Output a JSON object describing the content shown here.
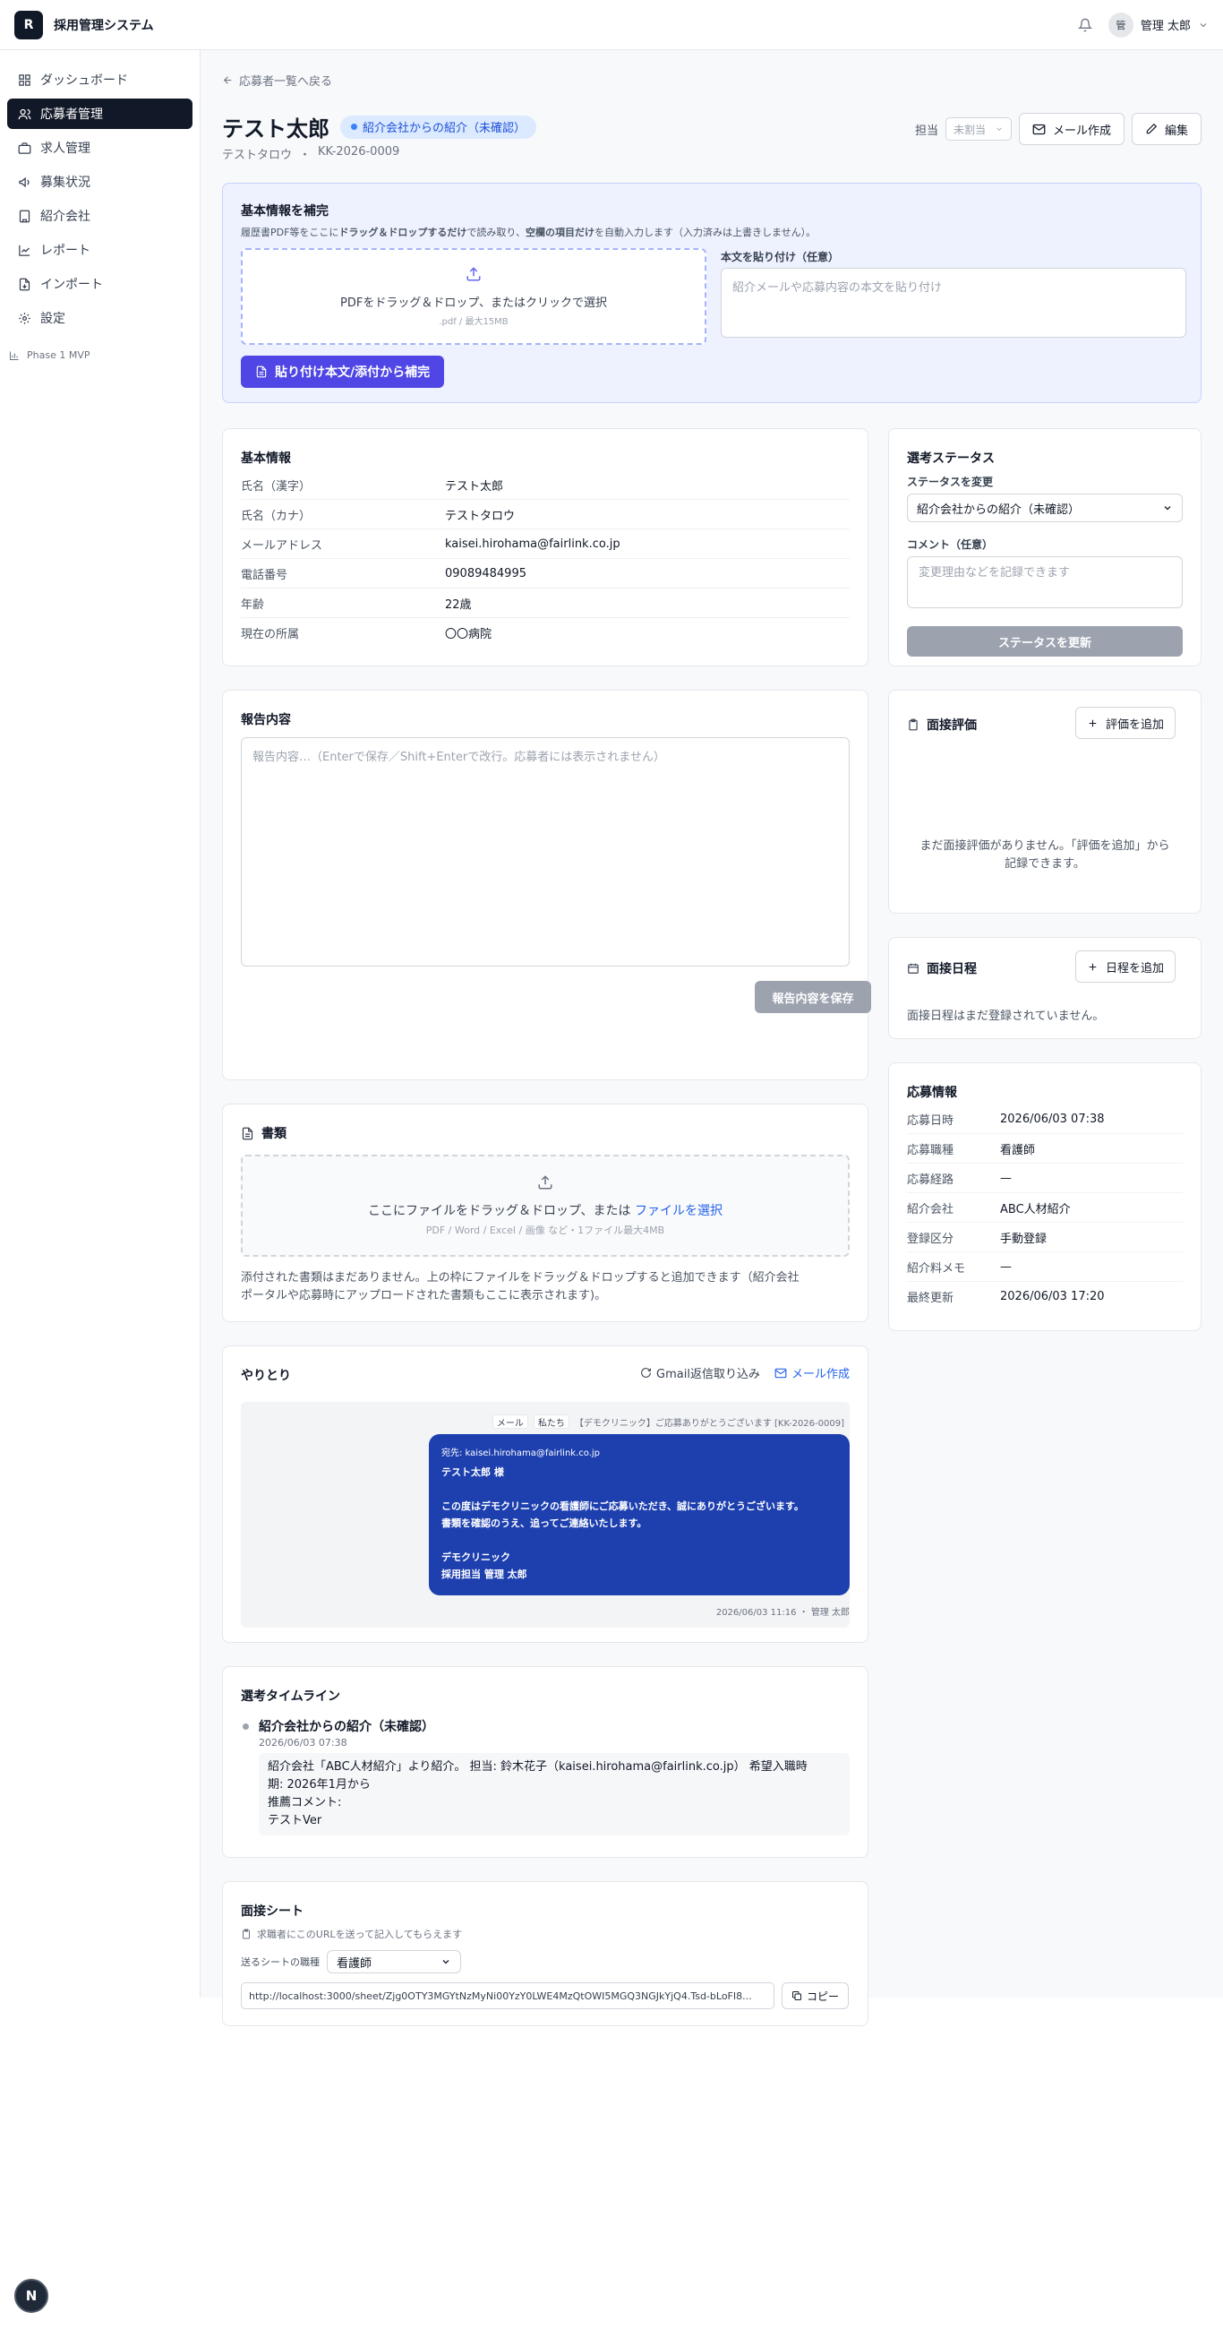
{
  "app": {
    "logo_letter": "R",
    "title": "採用管理システム",
    "user_initial": "管",
    "user_name": "管理 太郎"
  },
  "sidebar": {
    "items": [
      {
        "label": "ダッシュボード",
        "icon": "dashboard-icon"
      },
      {
        "label": "応募者管理",
        "icon": "users-icon",
        "active": true
      },
      {
        "label": "求人管理",
        "icon": "briefcase-icon"
      },
      {
        "label": "募集状況",
        "icon": "megaphone-icon"
      },
      {
        "label": "紹介会社",
        "icon": "building-icon"
      },
      {
        "label": "レポート",
        "icon": "chart-line-icon"
      },
      {
        "label": "インポート",
        "icon": "file-import-icon"
      },
      {
        "label": "設定",
        "icon": "gear-icon"
      }
    ],
    "phase_label": "Phase 1 MVP"
  },
  "page": {
    "back_link": "応募者一覧へ戻る",
    "name": "テスト太郎",
    "status_badge": "紹介会社からの紹介（未確認）",
    "kana": "テストタロウ",
    "separator": "・",
    "applicant_id": "KK-2026-0009",
    "assign_label": "担当",
    "assign_value": "未割当",
    "mail_button": "メール作成",
    "edit_button": "編集"
  },
  "supplement": {
    "title": "基本情報を補完",
    "desc_1": "履歴書PDF等をここに",
    "desc_2": "ドラッグ＆ドロップするだけ",
    "desc_3": "で読み取り、",
    "desc_4": "空欄の項目だけ",
    "desc_5": "を自動入力します（入力済みは上書きしません）。",
    "drop_text": "PDFをドラッグ＆ドロップ、またはクリックで選択",
    "drop_hint": ".pdf / 最大15MB",
    "paste_label": "本文を貼り付け（任意）",
    "paste_placeholder": "紹介メールや応募内容の本文を貼り付け",
    "button": "貼り付け本文/添付から補完"
  },
  "basic_info": {
    "title": "基本情報",
    "rows": [
      {
        "label": "氏名（漢字）",
        "value": "テスト太郎"
      },
      {
        "label": "氏名（カナ）",
        "value": "テストタロウ"
      },
      {
        "label": "メールアドレス",
        "value": "kaisei.hirohama@fairlink.co.jp"
      },
      {
        "label": "電話番号",
        "value": "09089484995"
      },
      {
        "label": "年齢",
        "value": "22歳"
      },
      {
        "label": "現在の所属",
        "value": "〇〇病院"
      }
    ]
  },
  "report": {
    "title": "報告内容",
    "placeholder": "報告内容…（Enterで保存／Shift+Enterで改行。応募者には表示されません）",
    "save_button": "報告内容を保存"
  },
  "documents": {
    "title": "書類",
    "drop_text": "ここにファイルをドラッグ＆ドロップ、または",
    "drop_link": "ファイルを選択",
    "drop_hint": "PDF / Word / Excel / 画像 など・1ファイル最大4MB",
    "empty_line1": "添付された書類はまだありません。上の枠にファイルをドラッグ＆ドロップすると追加できます（紹介会社",
    "empty_line2": "ポータルや応募時にアップロードされた書類もここに表示されます)。"
  },
  "messages": {
    "title": "やりとり",
    "gmail_button": "Gmail返信取り込み",
    "mail_button": "メール作成",
    "chip_type": "メール",
    "chip_sender": "私たち",
    "subject": "【デモクリニック】ご応募ありがとうございます [KK-2026-0009]",
    "to": "宛先: kaisei.hirohama@fairlink.co.jp",
    "line1": "テスト太郎 様",
    "line2": "この度はデモクリニックの看護師にご応募いただき、誠にありがとうございます。",
    "line3": "書類を確認のうえ、追ってご連絡いたします。",
    "line4": "デモクリニック",
    "line5": "採用担当 管理 太郎",
    "stamp": "2026/06/03 11:16 ・ 管理 太郎"
  },
  "timeline": {
    "title": "選考タイムライン",
    "item_title": "紹介会社からの紹介（未確認）",
    "item_date": "2026/06/03 07:38",
    "body_line1": "紹介会社「ABC人材紹介」より紹介。 担当: 鈴木花子（kaisei.hirohama@fairlink.co.jp） 希望入職時",
    "body_line2": "期: 2026年1月から",
    "body_line3": "推薦コメント:",
    "body_line4": "テストVer"
  },
  "interview_sheet": {
    "title": "面接シート",
    "hint": "求職者にこのURLを送って記入してもらえます",
    "job_label": "送るシートの職種",
    "job_value": "看護師",
    "url": "http://localhost:3000/sheet/Zjg0OTY3MGYtNzMyNi00YzY0LWE4MzQtOWI5MGQ3NGJkYjQ4.Tsd-bLoFI8...",
    "copy_button": "コピー"
  },
  "status_panel": {
    "title": "選考ステータス",
    "change_label": "ステータスを変更",
    "current_status": "紹介会社からの紹介（未確認）",
    "comment_label": "コメント（任意）",
    "comment_placeholder": "変更理由などを記録できます",
    "update_button": "ステータスを更新"
  },
  "evaluation": {
    "title": "面接評価",
    "add_button": "評価を追加",
    "empty_line1": "まだ面接評価がありません。「評価を追加」から",
    "empty_line2": "記録できます。"
  },
  "schedule": {
    "title": "面接日程",
    "add_button": "日程を追加",
    "empty": "面接日程はまだ登録されていません。"
  },
  "application": {
    "title": "応募情報",
    "rows": [
      {
        "label": "応募日時",
        "value": "2026/06/03 07:38"
      },
      {
        "label": "応募職種",
        "value": "看護師"
      },
      {
        "label": "応募経路",
        "value": "—"
      },
      {
        "label": "紹介会社",
        "value": "ABC人材紹介"
      },
      {
        "label": "登録区分",
        "value": "手動登録"
      },
      {
        "label": "紹介料メモ",
        "value": "—"
      },
      {
        "label": "最終更新",
        "value": "2026/06/03 17:20"
      }
    ]
  },
  "dev": {
    "next_badge": "N"
  },
  "colors": {
    "accent": "#4f46e5",
    "nav_active": "#111827",
    "bubble": "#1e40af",
    "badge_bg": "#dbeafe",
    "badge_text": "#1d4ed8"
  }
}
